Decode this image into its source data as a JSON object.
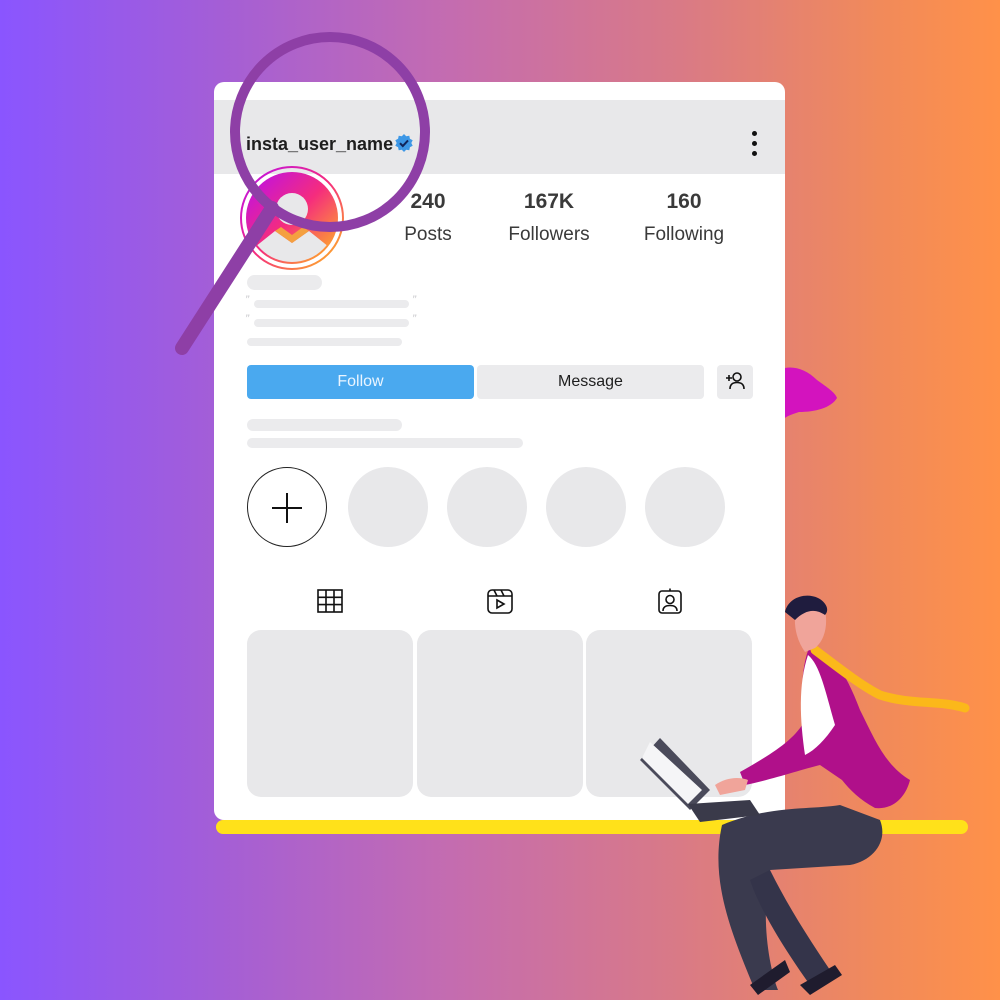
{
  "profile": {
    "username": "insta_user_name",
    "verified": true,
    "stats": [
      {
        "value": "240",
        "label": "Posts"
      },
      {
        "value": "167K",
        "label": "Followers"
      },
      {
        "value": "160",
        "label": "Following"
      }
    ]
  },
  "buttons": {
    "follow": "Follow",
    "message": "Message"
  },
  "icons": {
    "verified": "verified-badge-icon",
    "menu": "more-vertical-icon",
    "add_user": "add-user-icon",
    "add_story": "plus-icon",
    "tabs": [
      "grid-icon",
      "reels-icon",
      "tagged-icon"
    ]
  },
  "colors": {
    "follow_button": "#4aa9ef",
    "verified": "#3d97e6",
    "magnifier": "#8e3fa6",
    "accent_yellow": "#ffe11a",
    "background_start": "#8a55ff",
    "background_end": "#ff9149"
  },
  "highlights_count": 4,
  "posts_count": 3
}
